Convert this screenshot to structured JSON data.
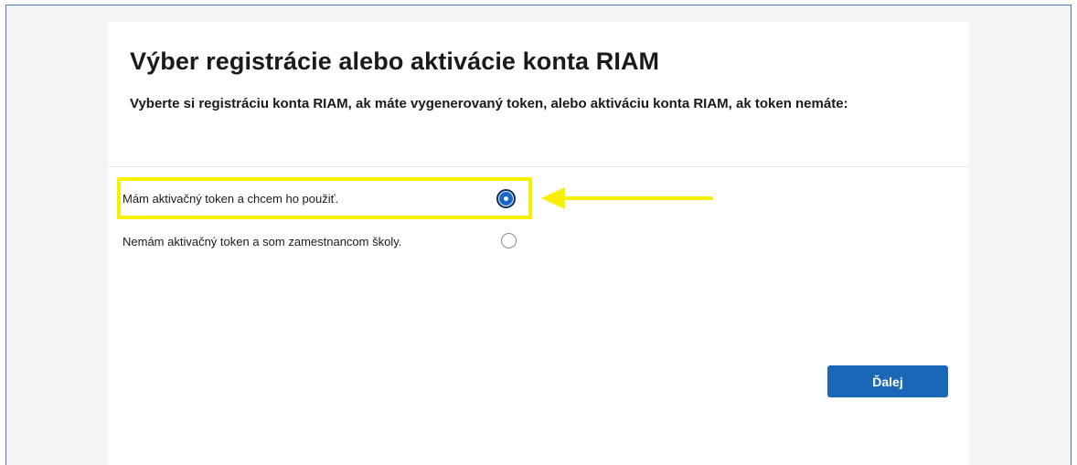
{
  "page": {
    "title": "Výber registrácie alebo aktivácie konta RIAM",
    "subtitle": "Vyberte si registráciu konta RIAM, ak máte vygenerovaný token, alebo aktiváciu konta RIAM, ak token nemáte:"
  },
  "options": [
    {
      "label": "Mám aktivačný token a chcem ho použiť.",
      "selected": true
    },
    {
      "label": "Nemám aktivačný token a som zamestnancom školy.",
      "selected": false
    }
  ],
  "actions": {
    "next_label": "Ďalej"
  },
  "colors": {
    "accent": "#1a67b8",
    "highlight": "#f7f000",
    "background": "#f4f4f4"
  }
}
